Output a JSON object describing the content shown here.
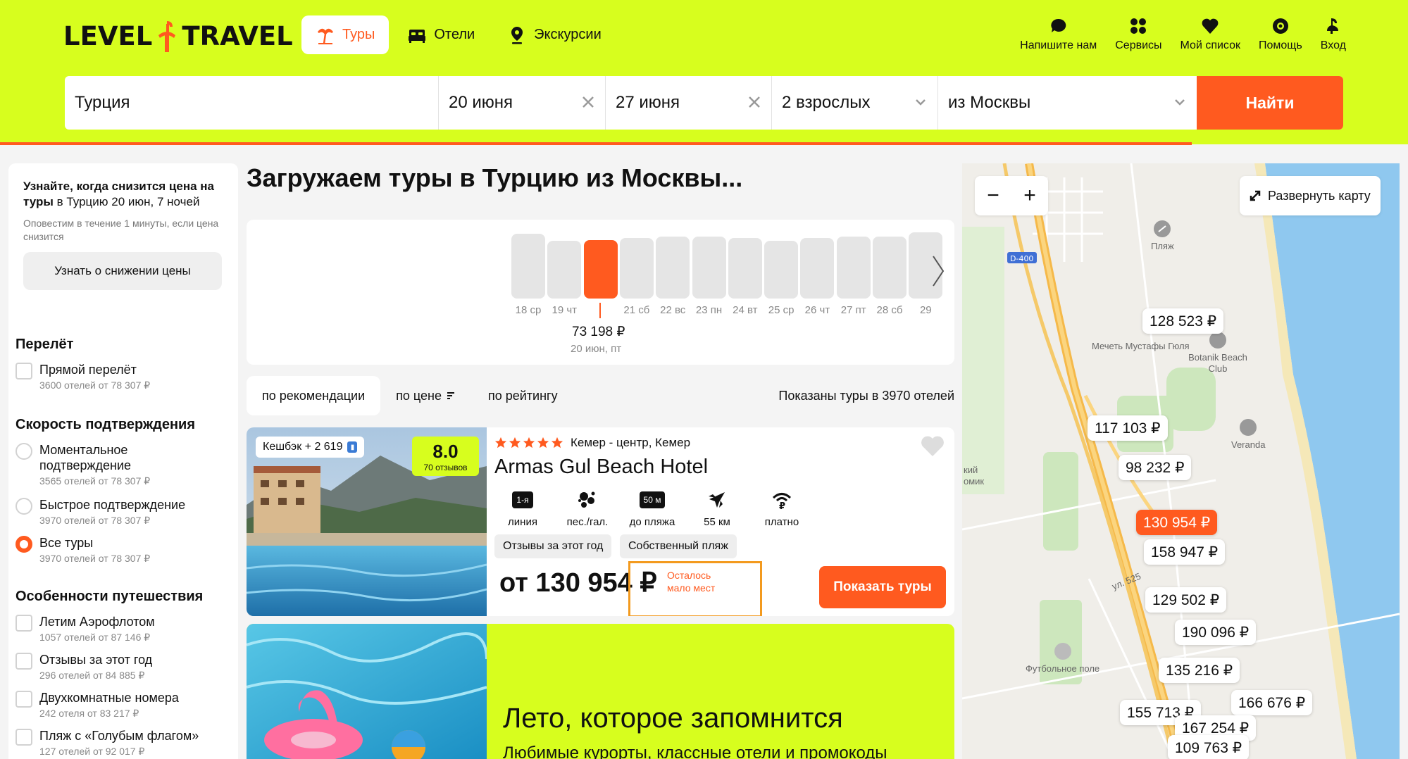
{
  "brand": {
    "left": "LEVEL",
    "right": "TRAVEL"
  },
  "nav": [
    {
      "label": "Туры",
      "icon": "palm-icon",
      "active": true
    },
    {
      "label": "Отели",
      "icon": "bed-icon"
    },
    {
      "label": "Экскурсии",
      "icon": "location-pin-icon"
    }
  ],
  "actions": [
    {
      "label": "Напишите нам",
      "icon": "chat-icon"
    },
    {
      "label": "Сервисы",
      "icon": "grid-icon"
    },
    {
      "label": "Мой список",
      "icon": "heart-icon"
    },
    {
      "label": "Помощь",
      "icon": "lifebuoy-icon"
    },
    {
      "label": "Вход",
      "icon": "user-bird-icon"
    }
  ],
  "search": {
    "destination": "Турция",
    "date_from": "20 июня",
    "date_to": "27 июня",
    "travelers": "2 взрослых",
    "departure": "из Москвы",
    "button": "Найти"
  },
  "sidebar": {
    "notify": {
      "title_bold": "Узнайте, когда снизится цена на туры",
      "title_rest": " в Турцию 20 июн, 7 ночей",
      "subtitle": "Оповестим в течение 1 минуты, если цена снизится",
      "button": "Узнать о снижении цены"
    },
    "flight": {
      "title": "Перелёт",
      "options": [
        {
          "label": "Прямой перелёт",
          "sub": "3600 отелей от 78 307 ₽"
        }
      ]
    },
    "confirm": {
      "title": "Скорость подтверждения",
      "options": [
        {
          "label": "Моментальное подтверждение",
          "sub": "3565 отелей от 78 307 ₽"
        },
        {
          "label": "Быстрое подтверждение",
          "sub": "3970 отелей от 78 307 ₽"
        },
        {
          "label": "Все туры",
          "sub": "3970 отелей от 78 307 ₽",
          "selected": true
        }
      ]
    },
    "features": {
      "title": "Особенности путешествия",
      "options": [
        {
          "label": "Летим Аэрофлотом",
          "sub": "1057 отелей от 87 146 ₽"
        },
        {
          "label": "Отзывы за этот год",
          "sub": "296 отелей от 84 885 ₽"
        },
        {
          "label": "Двухкомнатные номера",
          "sub": "242 отеля от 83 217 ₽"
        },
        {
          "label": "Пляж с «Голубым флагом»",
          "sub": "127 отелей от 92 017 ₽"
        }
      ]
    }
  },
  "main": {
    "title": "Загружаем туры в Турцию из Москвы...",
    "calendar": {
      "days": [
        {
          "label": "18 ср",
          "level": 0.92
        },
        {
          "label": "19 чт",
          "level": 0.82
        },
        {
          "label": "",
          "level": 0.83,
          "selected": true
        },
        {
          "label": "21 сб",
          "level": 0.86
        },
        {
          "label": "22 вс",
          "level": 0.88
        },
        {
          "label": "23 пн",
          "level": 0.88
        },
        {
          "label": "24 вт",
          "level": 0.86
        },
        {
          "label": "25 ср",
          "level": 0.82
        },
        {
          "label": "26 чт",
          "level": 0.86
        },
        {
          "label": "27 пт",
          "level": 0.88
        },
        {
          "label": "28 сб",
          "level": 0.88
        },
        {
          "label": "29",
          "level": 0.94
        }
      ],
      "selected_price": "73 198 ₽",
      "selected_date": "20 июн, пт"
    },
    "sort": {
      "recommend": "по рекомендации",
      "price": "по цене",
      "rating": "по рейтингу",
      "count": "Показаны туры в 3970 отелей"
    },
    "hotel": {
      "cashback": "Кешбэк + 2 619",
      "rating": "8.0",
      "reviews": "70 отзывов",
      "stars": 5,
      "location": "Кемер - центр, Кемер",
      "name": "Armas Gul Beach Hotel",
      "features": [
        {
          "tag": "1-я",
          "label": "линия"
        },
        {
          "icon": "pebbles-icon",
          "label": "пес./гал."
        },
        {
          "tag": "50 м",
          "label": "до пляжа"
        },
        {
          "icon": "plane-icon",
          "label": "55 км"
        },
        {
          "icon": "wifi-paid-icon",
          "label": "платно"
        }
      ],
      "chips": [
        "Отзывы за этот год",
        "Собственный пляж"
      ],
      "price": "от 130 954 ₽",
      "few_places": [
        "Осталось",
        "мало мест"
      ],
      "button": "Показать туры"
    },
    "promo": {
      "title": "Лето, которое запомнится",
      "subtitle": "Любимые курорты, классные отели и промокоды"
    }
  },
  "map": {
    "expand": "Развернуть карту",
    "pins": [
      {
        "price": "128 523 ₽"
      },
      {
        "price": "117 103 ₽"
      },
      {
        "price": "98 232 ₽"
      },
      {
        "price": "130 954 ₽",
        "highlight": true
      },
      {
        "price": "158 947 ₽"
      },
      {
        "price": "129 502 ₽"
      },
      {
        "price": "190 096 ₽"
      },
      {
        "price": "135 216 ₽"
      },
      {
        "price": "166 676 ₽"
      },
      {
        "price": "155 713 ₽"
      },
      {
        "price": "167 254 ₽"
      },
      {
        "price": "109 763 ₽"
      }
    ],
    "labels": [
      {
        "text": "Пляж"
      },
      {
        "text": "D-400"
      },
      {
        "text": "Мечеть Мустафы Гюля"
      },
      {
        "text": "Botanik Beach Club"
      },
      {
        "text": "Veranda"
      },
      {
        "text": "ул. 525"
      },
      {
        "text": "Футбольное поле"
      },
      {
        "text": "кий омик"
      }
    ]
  },
  "colors": {
    "accent": "#ff5a1f",
    "brand": "#d7fe1e"
  }
}
